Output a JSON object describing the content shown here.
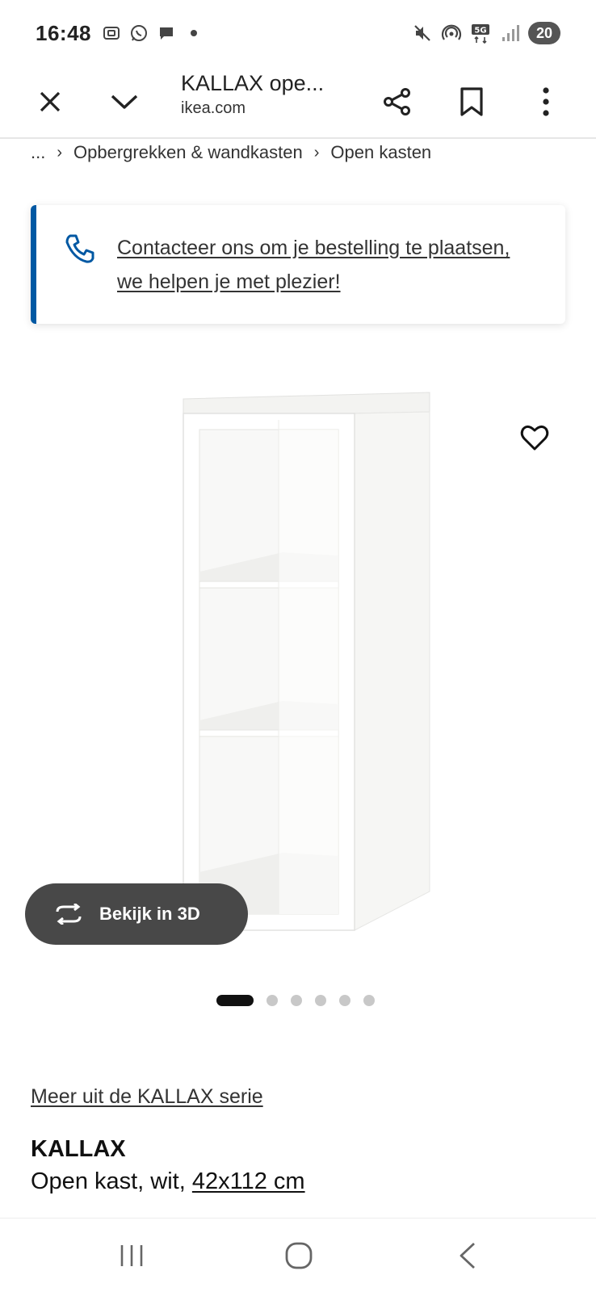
{
  "status_bar": {
    "time": "16:48",
    "battery": "20",
    "left_icons": [
      "screenshot-icon",
      "whatsapp-icon",
      "chat-icon",
      "dot-icon"
    ],
    "right_icons": [
      "mute-icon",
      "hotspot-icon",
      "5g-icon",
      "signal-icon"
    ]
  },
  "toolbar": {
    "title": "KALLAX ope...",
    "url": "ikea.com"
  },
  "breadcrumb": {
    "items": [
      "...",
      "Opbergrekken & wandkasten",
      "Open kasten"
    ]
  },
  "contact_banner": {
    "text": "Contacteer ons om je bestelling te plaatsen, we helpen je met plezier!",
    "accent_color": "#0058a3"
  },
  "product_image": {
    "view_3d_label": "Bekijk in 3D",
    "carousel": {
      "total": 6,
      "active_index": 0
    }
  },
  "product": {
    "series_link": "Meer uit de KALLAX serie",
    "name": "KALLAX",
    "desc_prefix": "Open kast, wit, ",
    "size": "42x112 cm"
  }
}
